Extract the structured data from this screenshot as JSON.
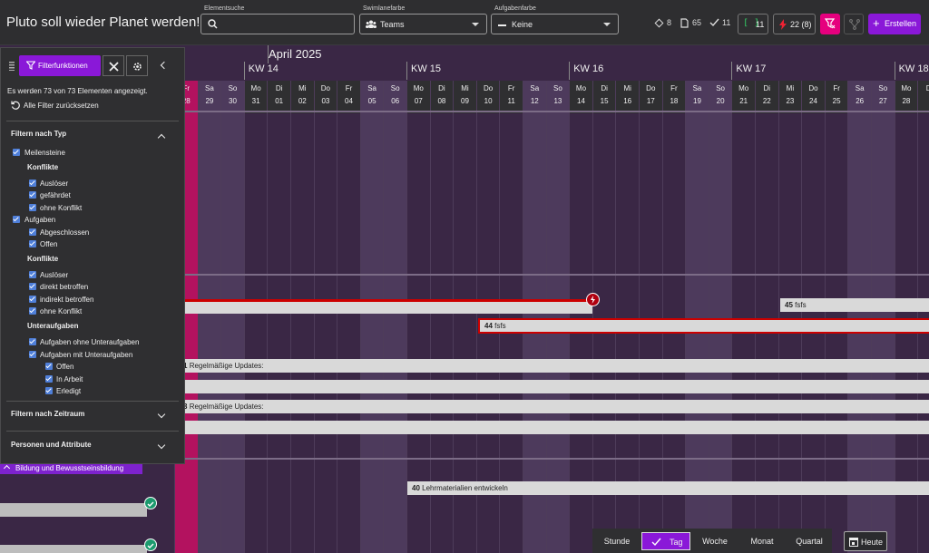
{
  "header": {
    "project_title": "Pluto soll wieder Planet werden!",
    "search": {
      "label": "Elementsuche",
      "placeholder": "",
      "value": ""
    },
    "swimlane": {
      "label": "Swimlanefarbe",
      "value": "Teams"
    },
    "taskcolor": {
      "label": "Aufgabenfarbe",
      "value": "Keine"
    },
    "stats": {
      "milestones": "8",
      "docs": "65",
      "done": "11",
      "bracket": "11",
      "conflicts": "22 (8)"
    },
    "create_label": "Erstellen"
  },
  "calendar": {
    "month_label": "April 2025",
    "weeks": [
      {
        "label": "KW 14"
      },
      {
        "label": "KW 15"
      },
      {
        "label": "KW 16"
      },
      {
        "label": "KW 17"
      },
      {
        "label": "KW 18"
      }
    ],
    "days": [
      {
        "dow": "Fr",
        "num": "28",
        "weekend": false,
        "today": true
      },
      {
        "dow": "Sa",
        "num": "29",
        "weekend": true
      },
      {
        "dow": "So",
        "num": "30",
        "weekend": true
      },
      {
        "dow": "Mo",
        "num": "31"
      },
      {
        "dow": "Di",
        "num": "01"
      },
      {
        "dow": "Mi",
        "num": "02"
      },
      {
        "dow": "Do",
        "num": "03"
      },
      {
        "dow": "Fr",
        "num": "04"
      },
      {
        "dow": "Sa",
        "num": "05",
        "weekend": true
      },
      {
        "dow": "So",
        "num": "06",
        "weekend": true
      },
      {
        "dow": "Mo",
        "num": "07"
      },
      {
        "dow": "Di",
        "num": "08"
      },
      {
        "dow": "Mi",
        "num": "09"
      },
      {
        "dow": "Do",
        "num": "10"
      },
      {
        "dow": "Fr",
        "num": "11"
      },
      {
        "dow": "Sa",
        "num": "12",
        "weekend": true
      },
      {
        "dow": "So",
        "num": "13",
        "weekend": true
      },
      {
        "dow": "Mo",
        "num": "14"
      },
      {
        "dow": "Di",
        "num": "15"
      },
      {
        "dow": "Mi",
        "num": "16"
      },
      {
        "dow": "Do",
        "num": "17"
      },
      {
        "dow": "Fr",
        "num": "18"
      },
      {
        "dow": "Sa",
        "num": "19",
        "weekend": true
      },
      {
        "dow": "So",
        "num": "20",
        "weekend": true
      },
      {
        "dow": "Mo",
        "num": "21"
      },
      {
        "dow": "Di",
        "num": "22"
      },
      {
        "dow": "Mi",
        "num": "23"
      },
      {
        "dow": "Do",
        "num": "24"
      },
      {
        "dow": "Fr",
        "num": "25"
      },
      {
        "dow": "Sa",
        "num": "26",
        "weekend": true
      },
      {
        "dow": "So",
        "num": "27",
        "weekend": true
      },
      {
        "dow": "Mo",
        "num": "28"
      },
      {
        "dow": "Di",
        "num": ""
      }
    ],
    "bars": {
      "b45": {
        "id": "45",
        "text": "fsfs"
      },
      "b44": {
        "id": "44",
        "text": "fsfs"
      },
      "b1": {
        "id": "1",
        "text": "Regelmäßige Updates:"
      },
      "b3": {
        "id": "3",
        "text": "Regelmäßige Updates:"
      },
      "b40": {
        "id": "40",
        "text": "Lehrmaterialien entwickeln"
      }
    },
    "swimlane_label": "Bildung und Bewusstseinsbildung"
  },
  "filter": {
    "tab_label": "Filterfunktionen",
    "count_text": "Es werden 73 von 73 Elementen angezeigt.",
    "reset_label": "Alle Filter zurücksetzen",
    "by_type": "Filtern nach Typ",
    "milestones": "Meilensteine",
    "conflicts": "Konflikte",
    "trigger": "Auslöser",
    "endangered": "gefährdet",
    "no_conflict": "ohne Konflikt",
    "tasks": "Aufgaben",
    "closed": "Abgeschlossen",
    "open": "Offen",
    "conflicts2": "Konflikte",
    "trigger2": "Auslöser",
    "direct": "direkt betroffen",
    "indirect": "indirekt betroffen",
    "no_conflict2": "ohne Konflikt",
    "subtasks": "Unteraufgaben",
    "tasks_without_sub": "Aufgaben ohne Unteraufgaben",
    "tasks_with_sub": "Aufgaben mit Unteraufgaben",
    "sub_open": "Offen",
    "sub_in_progress": "In Arbeit",
    "sub_done": "Erledigt",
    "by_time": "Filtern nach Zeitraum",
    "people_attr": "Personen und Attribute"
  },
  "viewbar": {
    "hour": "Stunde",
    "day": "Tag",
    "week": "Woche",
    "month": "Monat",
    "quarter": "Quartal",
    "today": "Heute"
  },
  "colors": {
    "accent": "#8a2be2",
    "pink": "#e6007e",
    "today": "#c0166e",
    "conflict": "#cc0000"
  }
}
